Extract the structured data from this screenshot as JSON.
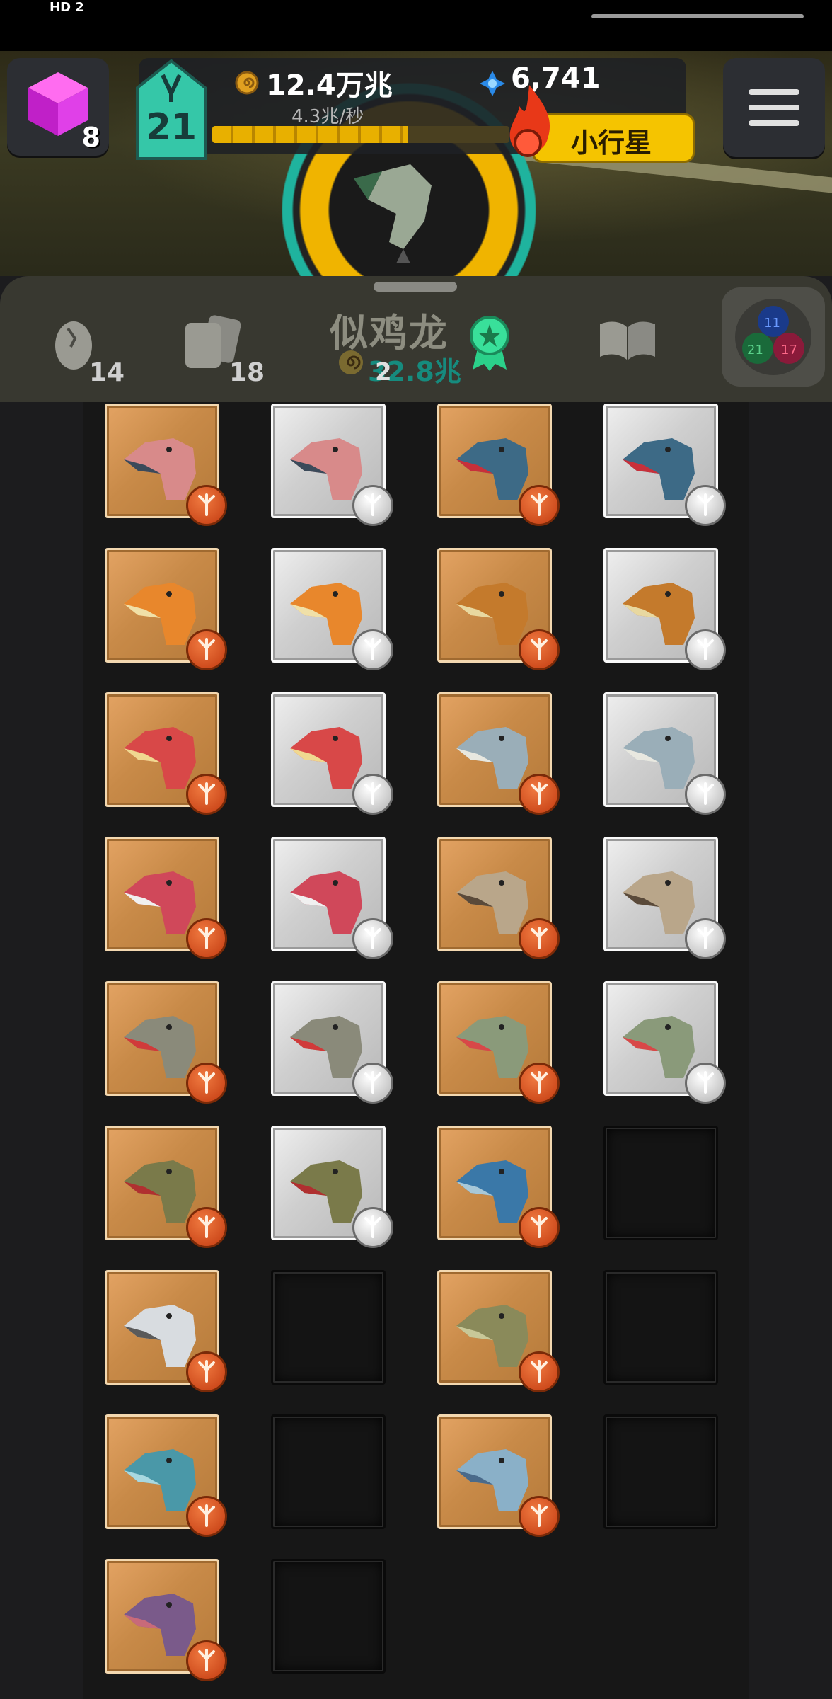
{
  "status_bar": {
    "left_text": "HD 2"
  },
  "hud": {
    "gem_count": "8",
    "level": "21",
    "coins": "12.4万兆",
    "gems": "6,741",
    "rate": "4.3兆/秒",
    "progress": 0.66,
    "rank": "小行星"
  },
  "tabs": {
    "eggs_count": "14",
    "cards_count": "18",
    "species_name": "似鸡龙",
    "species_value": "32.8兆",
    "species_count": "2",
    "mix_counts": [
      "11",
      "21",
      "17"
    ]
  },
  "collection": {
    "rows": [
      [
        {
          "tier": "bronze",
          "head": "pink-long"
        },
        {
          "tier": "silver",
          "head": "pink-long"
        },
        {
          "tier": "bronze",
          "head": "red-crest-jaws"
        },
        {
          "tier": "silver",
          "head": "red-crest-jaws"
        }
      ],
      [
        {
          "tier": "bronze",
          "head": "orange-beak"
        },
        {
          "tier": "silver",
          "head": "orange-beak"
        },
        {
          "tier": "bronze",
          "head": "orange-frill"
        },
        {
          "tier": "silver",
          "head": "orange-frill"
        }
      ],
      [
        {
          "tier": "bronze",
          "head": "yellow-crest"
        },
        {
          "tier": "silver",
          "head": "yellow-crest"
        },
        {
          "tier": "bronze",
          "head": "grey-longneck"
        },
        {
          "tier": "silver",
          "head": "grey-longneck"
        }
      ],
      [
        {
          "tier": "bronze",
          "head": "red-raptor"
        },
        {
          "tier": "silver",
          "head": "red-raptor"
        },
        {
          "tier": "bronze",
          "head": "tan-dome"
        },
        {
          "tier": "silver",
          "head": "tan-dome"
        }
      ],
      [
        {
          "tier": "bronze",
          "head": "grey-rex"
        },
        {
          "tier": "silver",
          "head": "grey-rex"
        },
        {
          "tier": "bronze",
          "head": "red-sail-jaws"
        },
        {
          "tier": "silver",
          "head": "red-sail-jaws"
        }
      ],
      [
        {
          "tier": "bronze",
          "head": "olive-lizard"
        },
        {
          "tier": "silver",
          "head": "olive-lizard"
        },
        {
          "tier": "bronze",
          "head": "blue-snout"
        },
        {
          "tier": "empty"
        }
      ],
      [
        {
          "tier": "bronze",
          "head": "white-spotted"
        },
        {
          "tier": "empty"
        },
        {
          "tier": "bronze",
          "head": "olive-flat"
        },
        {
          "tier": "empty"
        }
      ],
      [
        {
          "tier": "bronze",
          "head": "teal-jaws"
        },
        {
          "tier": "empty"
        },
        {
          "tier": "bronze",
          "head": "blue-spotted"
        },
        {
          "tier": "empty"
        }
      ],
      [
        {
          "tier": "bronze",
          "head": "purple-jaws"
        },
        {
          "tier": "empty"
        }
      ]
    ],
    "head_colors": {
      "pink-long": [
        "#d88a8a",
        "#3b4a5a"
      ],
      "red-crest-jaws": [
        "#3d6a86",
        "#c8303a"
      ],
      "orange-beak": [
        "#e8872c",
        "#f0e0a8"
      ],
      "orange-frill": [
        "#c47a2c",
        "#e8d8a0"
      ],
      "yellow-crest": [
        "#d84848",
        "#f0d890"
      ],
      "grey-longneck": [
        "#9aaeb8",
        "#e8e8e0"
      ],
      "red-raptor": [
        "#d0485a",
        "#f0f0f0"
      ],
      "tan-dome": [
        "#b9a68a",
        "#5a4a3a"
      ],
      "grey-rex": [
        "#8a8a7a",
        "#d03a3a"
      ],
      "red-sail-jaws": [
        "#8a9a7a",
        "#d84848"
      ],
      "olive-lizard": [
        "#7a7a4a",
        "#b03030"
      ],
      "blue-snout": [
        "#3a78a8",
        "#a8c8d8"
      ],
      "white-spotted": [
        "#d8dce0",
        "#5a5a5a"
      ],
      "olive-flat": [
        "#8a8a5a",
        "#c8c898"
      ],
      "teal-jaws": [
        "#4a98a8",
        "#a8d8e0"
      ],
      "blue-spotted": [
        "#8ab0c8",
        "#4a6a8a"
      ],
      "purple-jaws": [
        "#7a5a8a",
        "#c86a7a"
      ]
    }
  }
}
